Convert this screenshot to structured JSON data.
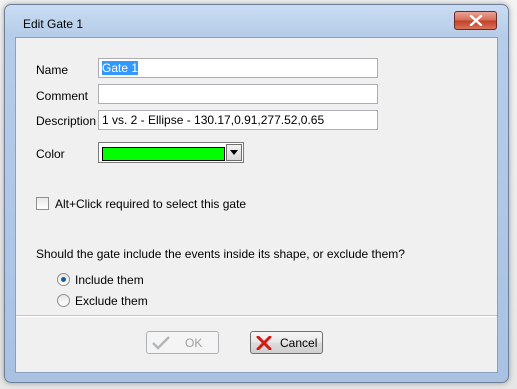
{
  "window": {
    "title": "Edit Gate 1"
  },
  "form": {
    "name_label": "Name",
    "name_value": "Gate 1",
    "comment_label": "Comment",
    "comment_value": "",
    "description_label": "Description",
    "description_value": "1 vs. 2 - Ellipse - 130.17,0.91,277.52,0.65",
    "color_label": "Color",
    "color_value": "#00ff00",
    "alt_click_label": "Alt+Click required to select this gate",
    "alt_click_checked": false,
    "question": "Should the gate include the events inside its shape, or exclude them?",
    "include_label": "Include them",
    "exclude_label": "Exclude them",
    "selected_option": "include"
  },
  "buttons": {
    "ok_label": "OK",
    "ok_enabled": false,
    "cancel_label": "Cancel"
  },
  "icons": {
    "close": "close-icon",
    "ok": "checkmark-icon",
    "cancel": "red-x-icon",
    "dropdown": "chevron-down-icon"
  }
}
